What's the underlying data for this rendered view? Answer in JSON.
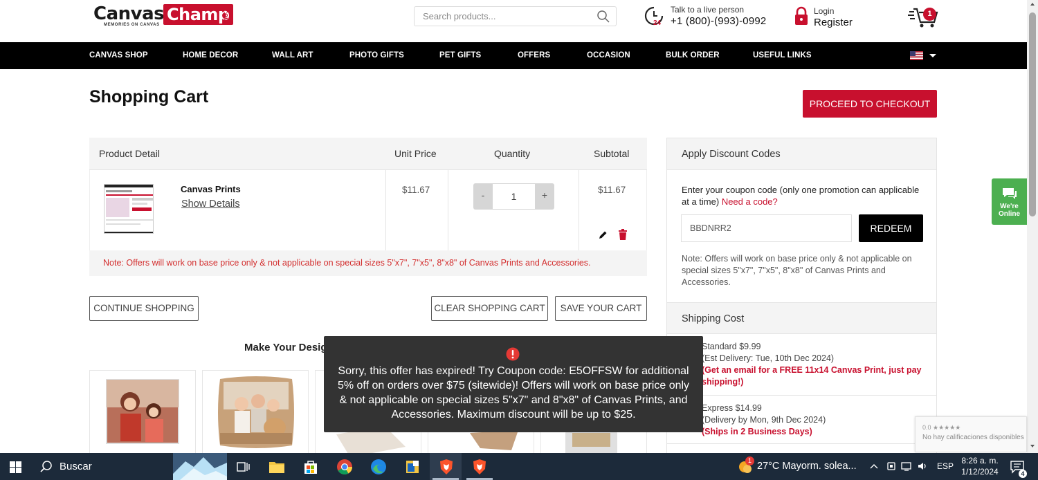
{
  "header": {
    "logo": {
      "canvas": "Canvas",
      "champ": "Champ",
      "com": ".COM",
      "tagline": "MEMORIES ON CANVAS"
    },
    "search_placeholder": "Search products...",
    "support": {
      "small": "Talk to a live person",
      "phone": "+1 (800)-(993)-0992"
    },
    "account": {
      "small": "Login",
      "big": "Register"
    },
    "cart_count": "1"
  },
  "nav": {
    "items": [
      "CANVAS SHOP",
      "HOME DECOR",
      "WALL ART",
      "PHOTO GIFTS",
      "PET GIFTS",
      "OFFERS",
      "OCCASION",
      "BULK ORDER",
      "USEFUL LINKS"
    ]
  },
  "page": {
    "title": "Shopping Cart",
    "checkout_label": "PROCEED TO CHECKOUT"
  },
  "cart": {
    "headers": {
      "product": "Product Detail",
      "unit_price": "Unit Price",
      "quantity": "Quantity",
      "subtotal": "Subtotal"
    },
    "item": {
      "name": "Canvas Prints",
      "show_details": "Show Details",
      "unit_price": "$11.67",
      "qty_minus": "-",
      "qty_value": "1",
      "qty_plus": "+",
      "subtotal": "$11.67"
    },
    "note": "Note: Offers will work on base price only & not applicable on special sizes 5\"x7\", 7\"x5\", 8\"x8\" of Canvas Prints and Accessories."
  },
  "actions": {
    "continue": "CONTINUE SHOPPING",
    "clear": "CLEAR SHOPPING CART",
    "save": "SAVE YOUR CART"
  },
  "gallery": {
    "heading": "Make Your Desig"
  },
  "discount": {
    "heading": "Apply Discount Codes",
    "label": "Enter your coupon code (only one promotion can applicable at a time)",
    "need_code": "Need a code?",
    "code_value": "BBDNRR2",
    "redeem": "REDEEM",
    "note": "Note: Offers will work on base price only & not applicable on special sizes 5\"x7\", 7\"x5\", 8\"x8\" of Canvas Prints and Accessories."
  },
  "shipping": {
    "heading": "Shipping Cost",
    "standard": {
      "line1": "Standard $9.99",
      "line2": "(Est Delivery: Tue, 10th Dec 2024)",
      "line3": "(Get an email for a FREE 11x14 Canvas Print, just pay shipping!)"
    },
    "express": {
      "line1": "Express $14.99",
      "line2": "(Delivery by Mon, 9th Dec 2024)",
      "line3": "(Ships in 2 Business Days)"
    }
  },
  "online_widget": {
    "line1": "We're",
    "line2": "Online"
  },
  "recaptcha": {
    "stars": "0.0 ★★★★★",
    "text": "No hay calificaciones disponibles"
  },
  "toast": {
    "message": "Sorry, this offer has expired! Try Coupon code: E5OFFSW for additional 5% off on orders over $75 (sitewide)! Offers will work on base price only & not applicable on special sizes 5\"x7\" and 8\"x8\" of Canvas Prints, and Accessories. Maximum discount will be up to $25."
  },
  "taskbar": {
    "search": "Buscar",
    "weather": "27°C  Mayorm. solea...",
    "weather_badge": "1",
    "lang": "ESP",
    "time": "8:26 a. m.",
    "date": "1/12/2024",
    "notif_count": "4"
  },
  "colors": {
    "brand_red": "#c8102e",
    "nav_bg": "#000000",
    "online_green": "#4caf50",
    "note_red": "#d32f2f"
  }
}
